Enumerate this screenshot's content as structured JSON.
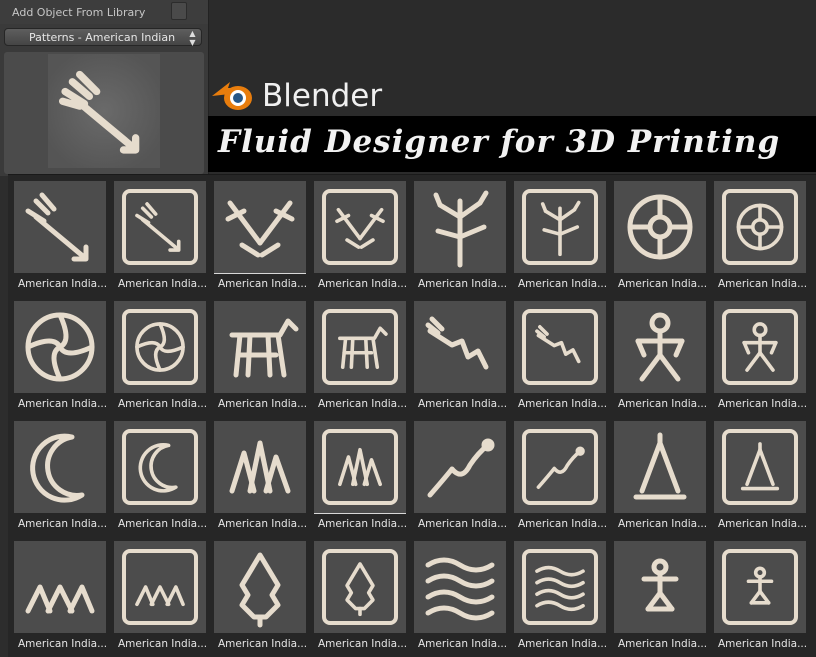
{
  "panel": {
    "title": "Add Object From Library",
    "dropdown_value": "Patterns - American Indian",
    "dropdown_arrows": "▲▼"
  },
  "header": {
    "app_name": "Blender",
    "banner": "Fluid Designer for 3D Printing"
  },
  "colors": {
    "accent_orange": "#e87d0d",
    "logo_blue": "#265787",
    "icon_stroke": "#e6dccd"
  },
  "library_items": [
    {
      "label": "American India...",
      "icon": "arrow-icon"
    },
    {
      "label": "American India...",
      "icon": "arrow-framed-icon"
    },
    {
      "label": "American India...",
      "icon": "crossed-arrows-icon"
    },
    {
      "label": "American India...",
      "icon": "crossed-arrows-framed-icon"
    },
    {
      "label": "American India...",
      "icon": "tree-branch-icon"
    },
    {
      "label": "American India...",
      "icon": "tree-branch-framed-icon"
    },
    {
      "label": "American India...",
      "icon": "sun-circle-icon"
    },
    {
      "label": "American India...",
      "icon": "sun-circle-framed-icon"
    },
    {
      "label": "American India...",
      "icon": "swirl-icon"
    },
    {
      "label": "American India...",
      "icon": "swirl-framed-icon"
    },
    {
      "label": "American India...",
      "icon": "horse-icon"
    },
    {
      "label": "American India...",
      "icon": "horse-framed-icon"
    },
    {
      "label": "American India...",
      "icon": "lightning-arrow-icon"
    },
    {
      "label": "American India...",
      "icon": "lightning-arrow-framed-icon"
    },
    {
      "label": "American India...",
      "icon": "figure-icon"
    },
    {
      "label": "American India...",
      "icon": "figure-framed-icon"
    },
    {
      "label": "American India...",
      "icon": "moon-icon"
    },
    {
      "label": "American India...",
      "icon": "moon-framed-icon"
    },
    {
      "label": "American India...",
      "icon": "mountains-icon"
    },
    {
      "label": "American India...",
      "icon": "mountains-framed-icon"
    },
    {
      "label": "American India...",
      "icon": "snake-icon"
    },
    {
      "label": "American India...",
      "icon": "snake-framed-icon"
    },
    {
      "label": "American India...",
      "icon": "teepee-icon"
    },
    {
      "label": "American India...",
      "icon": "teepee-framed-icon"
    },
    {
      "label": "American India...",
      "icon": "teepees-icon"
    },
    {
      "label": "American India...",
      "icon": "teepees-framed-icon"
    },
    {
      "label": "American India...",
      "icon": "arrowhead-icon"
    },
    {
      "label": "American India...",
      "icon": "arrowhead-framed-icon"
    },
    {
      "label": "American India...",
      "icon": "waves-icon"
    },
    {
      "label": "American India...",
      "icon": "waves-framed-icon"
    },
    {
      "label": "American India...",
      "icon": "small-figure-icon"
    },
    {
      "label": "American India...",
      "icon": "small-figure-framed-icon"
    }
  ]
}
